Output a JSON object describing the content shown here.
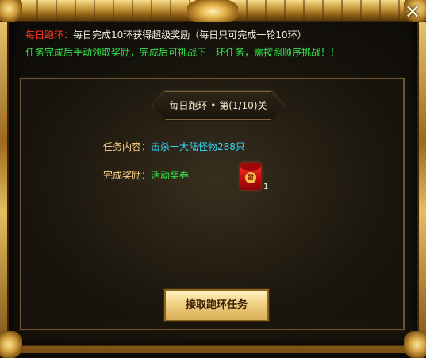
{
  "window": {
    "close_symbol": "✕"
  },
  "notice": {
    "line1_prefix": "每日跑环：",
    "line1_main": "每日完成10环获得超级奖励",
    "line1_note": "（每日只可完成一轮10环）",
    "line2": "任务完成后手动领取奖励，完成后可挑战下一环任务，需按照顺序挑战！！"
  },
  "banner": {
    "title": "每日跑环 • 第(1/10)关"
  },
  "task": {
    "content_label": "任务内容：",
    "content_value": "击杀一大陆怪物288只",
    "reward_label": "完成奖励：",
    "reward_value": "活动奖券"
  },
  "reward_item": {
    "icon": "red-envelope-icon",
    "glyph": "發",
    "count": "1"
  },
  "actions": {
    "accept_label": "接取跑环任务"
  },
  "colors": {
    "frame_gold": "#d4a84a",
    "prefix_red": "#ff3a2a",
    "notice_green": "#35e04a",
    "task_cyan": "#34d8ff",
    "label_orange": "#ffd28a",
    "button_gold": "#f3d48a"
  }
}
